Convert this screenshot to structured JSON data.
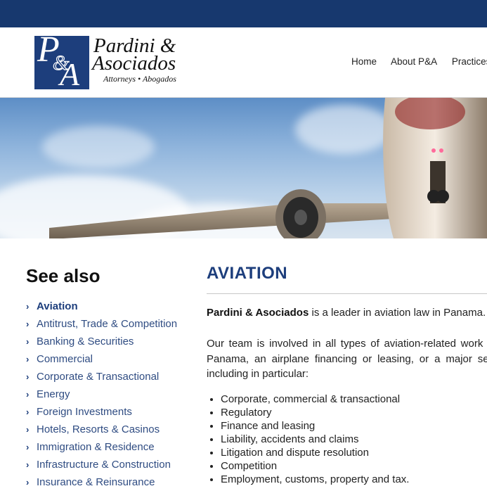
{
  "header": {
    "logo": {
      "monogram_p": "P",
      "monogram_amp": "&",
      "monogram_a": "A",
      "name_line1": "Pardini &",
      "name_line2": "Asociados",
      "tagline": "Attorneys • Abogados"
    },
    "nav": [
      "Home",
      "About P&A",
      "Practices"
    ]
  },
  "sidebar": {
    "title": "See also",
    "items": [
      "Aviation",
      "Antitrust, Trade & Competition",
      "Banking & Securities",
      "Commercial",
      "Corporate & Transactional",
      "Energy",
      "Foreign Investments",
      "Hotels, Resorts & Casinos",
      "Immigration & Residence",
      "Infrastructure & Construction",
      "Insurance & Reinsurance"
    ],
    "active_index": 0
  },
  "main": {
    "title": "AVIATION",
    "intro_bold": "Pardini & Asociados",
    "intro_rest": " is a leader in aviation law in Panama.",
    "paragraph": "Our team is involved in all types of aviation-related work from Panama, an airplane financing or leasing, or a major sector, including in particular:",
    "bullets": [
      "Corporate, commercial & transactional",
      "Regulatory",
      "Finance and leasing",
      "Liability, accidents and claims",
      "Litigation and dispute resolution",
      "Competition",
      "Employment, customs, property and tax."
    ]
  },
  "colors": {
    "brand_navy": "#17386e",
    "link_blue": "#2f4c82",
    "heading_blue": "#1d3e7c"
  },
  "icons": {
    "list_bullet": "chevron-right-icon"
  }
}
